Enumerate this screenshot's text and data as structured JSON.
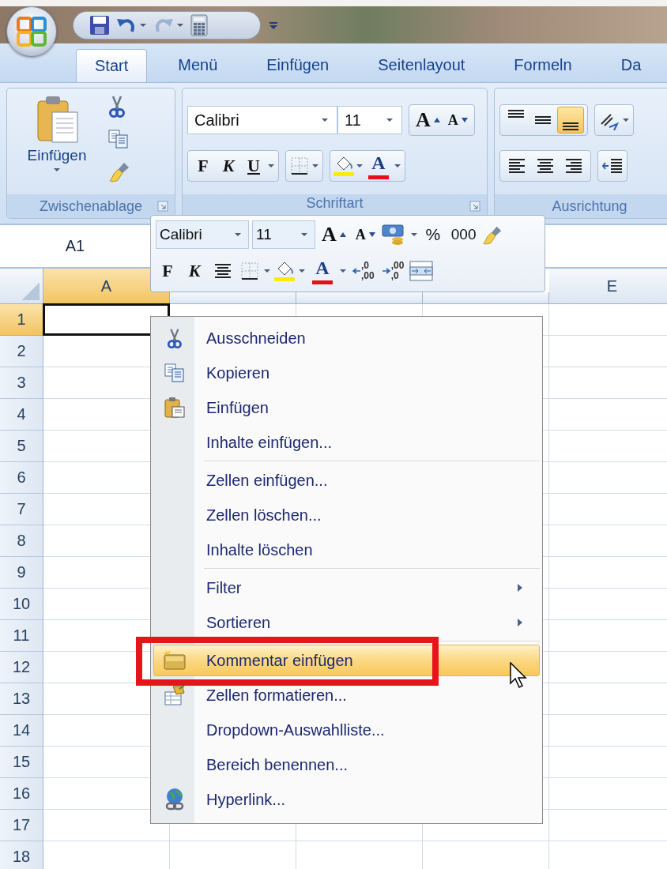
{
  "tabs": [
    {
      "label": "Start",
      "selected": true
    },
    {
      "label": "Menü",
      "selected": false
    },
    {
      "label": "Einfügen",
      "selected": false
    },
    {
      "label": "Seitenlayout",
      "selected": false
    },
    {
      "label": "Formeln",
      "selected": false
    },
    {
      "label": "Da",
      "selected": false
    }
  ],
  "ribbon": {
    "clipboard": {
      "label": "Zwischenablage",
      "paste": "Einfügen"
    },
    "font": {
      "label": "Schriftart",
      "font_name": "Calibri",
      "font_size": "11",
      "grow": "A",
      "shrink": "A",
      "bold": "F",
      "italic": "K",
      "underline": "U",
      "font_color": "A"
    },
    "alignment": {
      "label": "Ausrichtung",
      "vertical": [
        {
          "selected": false
        },
        {
          "selected": false
        },
        {
          "selected": true
        }
      ]
    }
  },
  "name_box": "A1",
  "mini_toolbar": {
    "font_name": "Calibri",
    "font_size": "11",
    "grow": "A",
    "shrink": "A",
    "percent": "%",
    "thousands": "000",
    "bold": "F",
    "italic": "K",
    "font_color": "A",
    "increase_decimal": [
      ",0",
      ",00"
    ],
    "decrease_decimal": [
      ",00",
      ",0"
    ]
  },
  "columns": [
    {
      "label": "A",
      "selected": true
    },
    {
      "selected": false
    },
    {
      "selected": false
    },
    {
      "selected": false
    },
    {
      "label": "E",
      "selected": false
    }
  ],
  "rows": [
    {
      "label": "1",
      "selected": true
    },
    {
      "label": "2",
      "selected": false
    },
    {
      "label": "3",
      "selected": false
    },
    {
      "label": "4",
      "selected": false
    },
    {
      "label": "5",
      "selected": false
    },
    {
      "label": "6",
      "selected": false
    },
    {
      "label": "7",
      "selected": false
    },
    {
      "label": "8",
      "selected": false
    },
    {
      "label": "9",
      "selected": false
    },
    {
      "label": "10",
      "selected": false
    },
    {
      "label": "11",
      "selected": false
    },
    {
      "label": "12",
      "selected": false
    },
    {
      "label": "13",
      "selected": false
    },
    {
      "label": "14",
      "selected": false
    },
    {
      "label": "15",
      "selected": false
    },
    {
      "label": "16",
      "selected": false
    },
    {
      "label": "17",
      "selected": false
    },
    {
      "label": "18",
      "selected": false
    }
  ],
  "context_menu": [
    {
      "kind": "cut",
      "label": "Ausschneiden",
      "selected": false
    },
    {
      "kind": "copy",
      "label": "Kopieren",
      "selected": false
    },
    {
      "kind": "paste",
      "label": "Einfügen",
      "selected": false
    },
    {
      "kind": "plain",
      "label": "Inhalte einfügen...",
      "selected": false
    },
    {
      "kind": "separator"
    },
    {
      "kind": "plain",
      "label": "Zellen einfügen...",
      "selected": false
    },
    {
      "kind": "plain",
      "label": "Zellen löschen...",
      "selected": false
    },
    {
      "kind": "plain",
      "label": "Inhalte löschen",
      "selected": false
    },
    {
      "kind": "separator"
    },
    {
      "kind": "submenu",
      "label": "Filter",
      "selected": false
    },
    {
      "kind": "submenu",
      "label": "Sortieren",
      "selected": false
    },
    {
      "kind": "separator"
    },
    {
      "kind": "comment",
      "label": "Kommentar einfügen",
      "selected": true
    },
    {
      "kind": "format",
      "label": "Zellen formatieren...",
      "selected": false
    },
    {
      "kind": "plain",
      "label": "Dropdown-Auswahlliste...",
      "selected": false
    },
    {
      "kind": "plain",
      "label": "Bereich benennen...",
      "selected": false
    },
    {
      "kind": "hyperlink",
      "label": "Hyperlink...",
      "selected": false
    }
  ]
}
